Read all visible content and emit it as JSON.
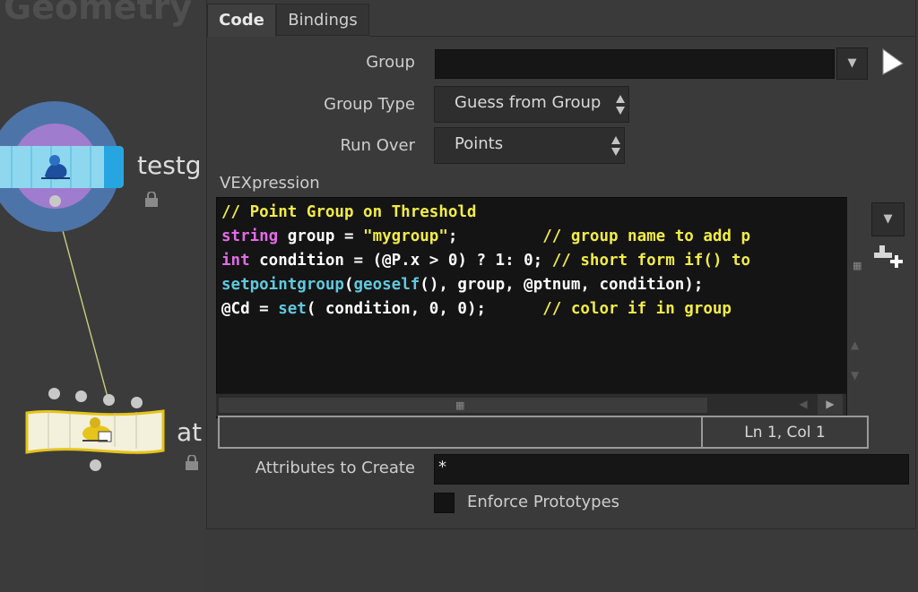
{
  "network": {
    "title": "Geometry",
    "node1": {
      "label": "testg",
      "icon": "wrangle-node-icon",
      "color": "#6fc7e6",
      "ring_color": "#4d74a8"
    },
    "node2": {
      "label": "at",
      "icon": "attribwrangle-node-icon",
      "color": "#f4e98a"
    }
  },
  "tabs": [
    {
      "label": "Code",
      "active": true
    },
    {
      "label": "Bindings",
      "active": false
    }
  ],
  "params": {
    "group": {
      "label": "Group",
      "value": ""
    },
    "group_type": {
      "label": "Group Type",
      "value": "Guess from Group"
    },
    "run_over": {
      "label": "Run Over",
      "value": "Points"
    },
    "vexpression": {
      "label": "VEXpression",
      "lines": [
        "// Point Group on Threshold",
        "string group = \"mygroup\";         // group name to add p",
        "int condition = (@P.x > 0) ? 1: 0; // short form if() to",
        "setpointgroup(geoself(), group, @ptnum, condition);",
        "@Cd = set( condition, 0, 0);      // color if in group"
      ]
    },
    "cursor_position": "Ln 1, Col 1",
    "attributes_to_create": {
      "label": "Attributes to Create",
      "value": "*"
    },
    "enforce_prototypes": {
      "label": "Enforce Prototypes",
      "checked": false
    }
  },
  "colors": {
    "comment": "#f2ec46",
    "keyword": "#e16be6",
    "function": "#5fc9e0",
    "string": "#f2ec46"
  }
}
